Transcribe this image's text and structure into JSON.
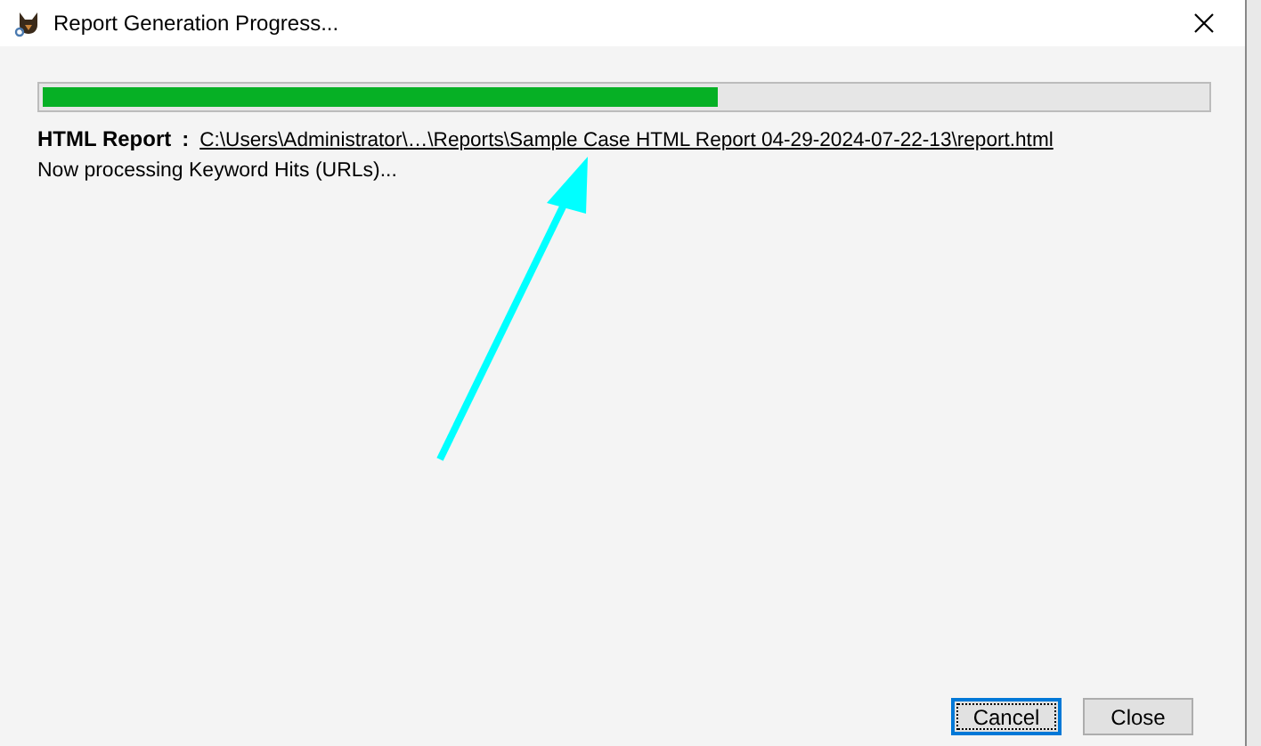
{
  "window": {
    "title": "Report Generation Progress..."
  },
  "progress": {
    "level": 0.58
  },
  "report": {
    "label": "HTML Report",
    "separator": ":",
    "path": "C:\\Users\\Administrator\\…\\Reports\\Sample Case HTML Report 04-29-2024-07-22-13\\report.html"
  },
  "status": "Now processing Keyword Hits (URLs)...",
  "buttons": [
    {
      "label": "Cancel",
      "focused": true
    },
    {
      "label": "Close",
      "focused": false
    }
  ]
}
